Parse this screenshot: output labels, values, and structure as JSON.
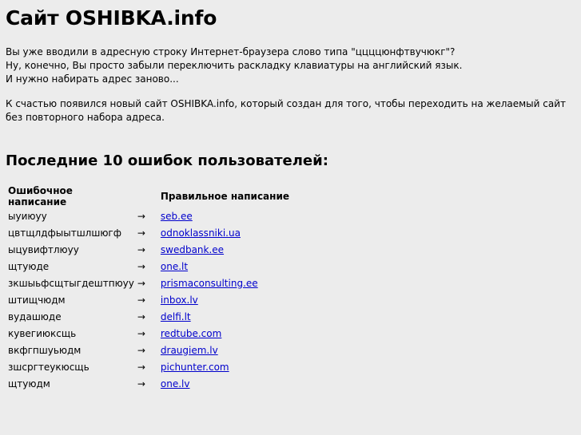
{
  "title": "Сайт OSHIBKA.info",
  "intro": {
    "line1": "Вы уже вводили в адресную строку Интернет-браузера слово типа \"ццццюнфтвучюкг\"?",
    "line2": "Ну, конечно, Вы просто забыли переключить раскладку клавиатуры на английский язык.",
    "line3": "И нужно набирать адрес заново..."
  },
  "note": "К счастью появился новый сайт OSHIBKA.info, который создан для того, чтобы переходить на желаемый сайт без повторного набора адреса.",
  "errors_heading": "Последние 10 ошибок пользователей:",
  "table": {
    "header_wrong": "Ошибочное написание",
    "header_right": "Правильное написание",
    "arrow": "→",
    "rows": [
      {
        "wrong": "ыуиюуу",
        "right": "seb.ee"
      },
      {
        "wrong": "цвтщлдфыытшлшюгф",
        "right": "odnoklassniki.ua"
      },
      {
        "wrong": "ыцувифтлюуу",
        "right": "swedbank.ee"
      },
      {
        "wrong": "щтуюде",
        "right": "one.lt"
      },
      {
        "wrong": "зкшыьфсщтыгдештпюуу",
        "right": "prismaconsulting.ee"
      },
      {
        "wrong": "штищчюдм",
        "right": "inbox.lv"
      },
      {
        "wrong": "вудашюде",
        "right": "delfi.lt"
      },
      {
        "wrong": "кувегиюксщь",
        "right": "redtube.com"
      },
      {
        "wrong": "вкфгпшуьюдм",
        "right": "draugiem.lv"
      },
      {
        "wrong": "зшсргтеукюсщь",
        "right": "pichunter.com"
      },
      {
        "wrong": "щтуюдм",
        "right": "one.lv"
      }
    ]
  },
  "colors": {
    "background": "#ececec",
    "text": "#000000",
    "link": "#0000cc"
  }
}
